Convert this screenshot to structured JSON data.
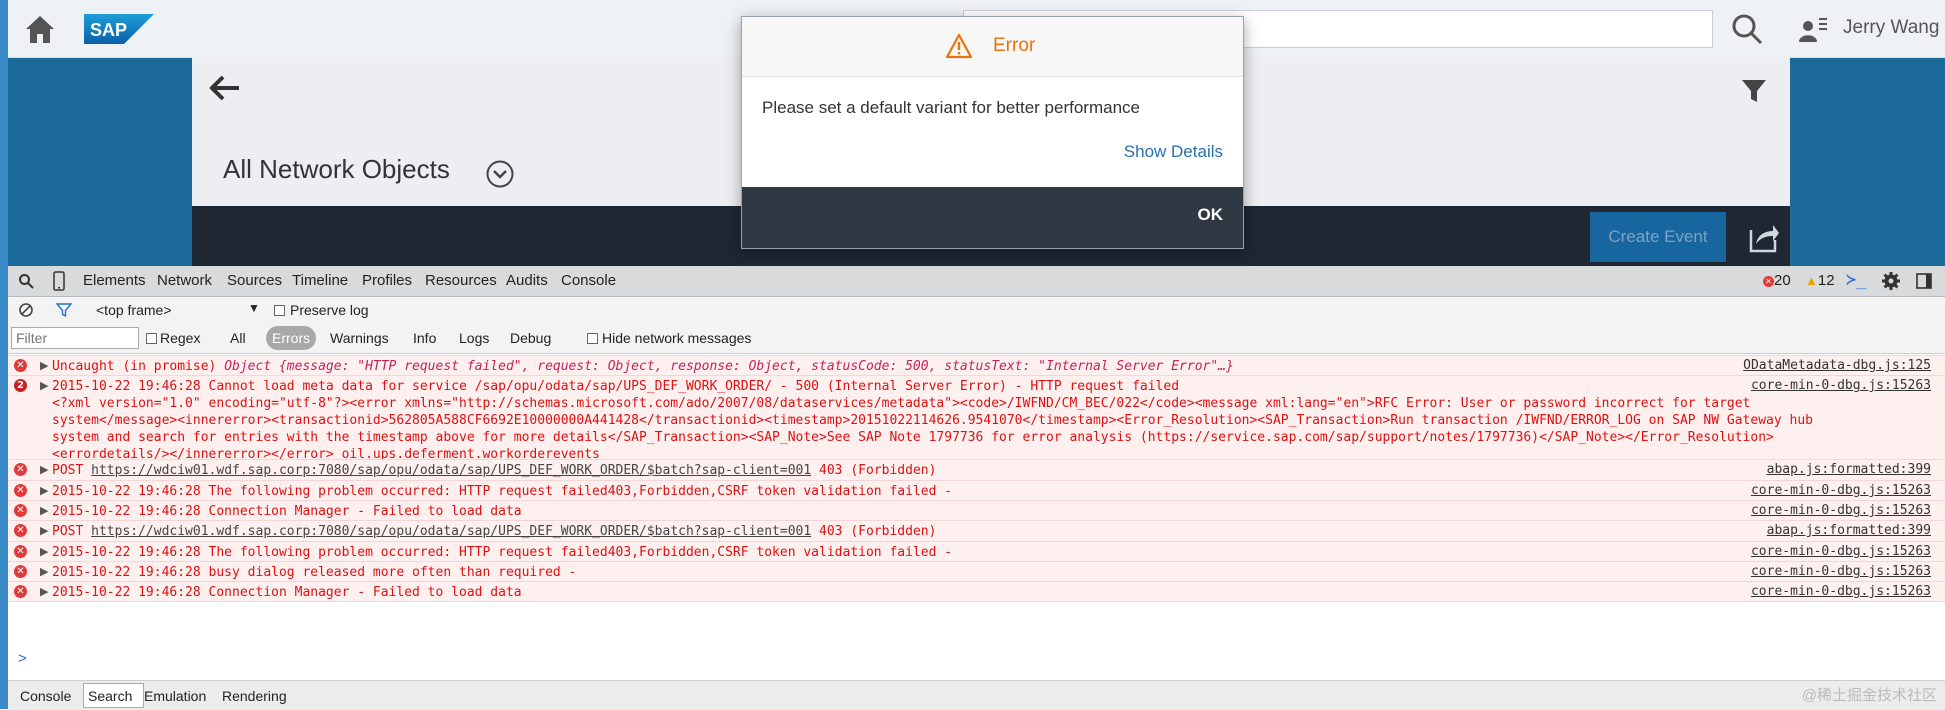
{
  "shell": {
    "logo_text": "SAP",
    "user_name": "Jerry Wang"
  },
  "page": {
    "title": "All Network Objects",
    "create_event_label": "Create Event"
  },
  "dialog": {
    "title": "Error",
    "message": "Please set a default variant for better performance",
    "show_details": "Show Details",
    "ok": "OK"
  },
  "devtools": {
    "tabs": [
      "Elements",
      "Network",
      "Sources",
      "Timeline",
      "Profiles",
      "Resources",
      "Audits",
      "Console"
    ],
    "error_count": "20",
    "warning_count": "12",
    "frame": "<top frame>",
    "preserve_log": "Preserve log",
    "filter_placeholder": "Filter",
    "regex": "Regex",
    "levels": [
      "All",
      "Errors",
      "Warnings",
      "Info",
      "Logs",
      "Debug"
    ],
    "hide_network": "Hide network messages",
    "drawer_tabs": [
      "Console",
      "Search",
      "Emulation",
      "Rendering"
    ],
    "prompt": ">"
  },
  "console": {
    "rows": [
      {
        "badge": "",
        "text": "Uncaught (in promise) ",
        "italic": "Object {message: \"HTTP request failed\", request: Object, response: Object, statusCode: 500, statusText: \"Internal Server Error\"…}",
        "source": "ODataMetadata-dbg.js:125"
      },
      {
        "badge": "2",
        "text": "2015-10-22 19:46:28 Cannot load meta data for service /sap/opu/odata/sap/UPS_DEF_WORK_ORDER/ - 500 (Internal Server Error) - HTTP request failed\n<?xml version=\"1.0\" encoding=\"utf-8\"?><error xmlns=\"http://schemas.microsoft.com/ado/2007/08/dataservices/metadata\"><code>/IWFND/CM_BEC/022</code><message xml:lang=\"en\">RFC Error: User or password incorrect for target\nsystem</message><innererror><transactionid>562805A588CF6692E10000000A441428</transactionid><timestamp>20151022114626.9541070</timestamp><Error_Resolution><SAP_Transaction>Run transaction /IWFND/ERROR_LOG on SAP NW Gateway hub\nsystem and search for entries with the timestamp above for more details</SAP_Transaction><SAP_Note>See SAP Note 1797736 for error analysis (https://service.sap.com/sap/support/notes/1797736)</SAP_Note></Error_Resolution>\n<errordetails/></innererror></error> oil.ups.deferment.workorderevents",
        "source": "core-min-0-dbg.js:15263"
      },
      {
        "badge": "",
        "prefix": "POST ",
        "link": "https://wdciw01.wdf.sap.corp:7080/sap/opu/odata/sap/UPS_DEF_WORK_ORDER/$batch?sap-client=001",
        "suffix": " 403 (Forbidden)",
        "source": "abap.js:formatted:399"
      },
      {
        "badge": "",
        "text": "2015-10-22 19:46:28 The following problem occurred: HTTP request failed403,Forbidden,CSRF token validation failed -",
        "source": "core-min-0-dbg.js:15263"
      },
      {
        "badge": "",
        "text": "2015-10-22 19:46:28 Connection Manager - Failed to load data",
        "source": "core-min-0-dbg.js:15263"
      },
      {
        "badge": "",
        "prefix": "POST ",
        "link": "https://wdciw01.wdf.sap.corp:7080/sap/opu/odata/sap/UPS_DEF_WORK_ORDER/$batch?sap-client=001",
        "suffix": " 403 (Forbidden)",
        "source": "abap.js:formatted:399"
      },
      {
        "badge": "",
        "text": "2015-10-22 19:46:28 The following problem occurred: HTTP request failed403,Forbidden,CSRF token validation failed -",
        "source": "core-min-0-dbg.js:15263"
      },
      {
        "badge": "",
        "text": "2015-10-22 19:46:28 busy dialog released more often than required -",
        "source": "core-min-0-dbg.js:15263"
      },
      {
        "badge": "",
        "text": "2015-10-22 19:46:28 Connection Manager - Failed to load data",
        "source": "core-min-0-dbg.js:15263"
      }
    ]
  },
  "watermark": "@稀土掘金技术社区",
  "colors": {
    "error_red": "#d11111",
    "dialog_accent": "#e9730c",
    "link_blue": "#2a70b0",
    "app_blue": "#1c6a9a"
  }
}
